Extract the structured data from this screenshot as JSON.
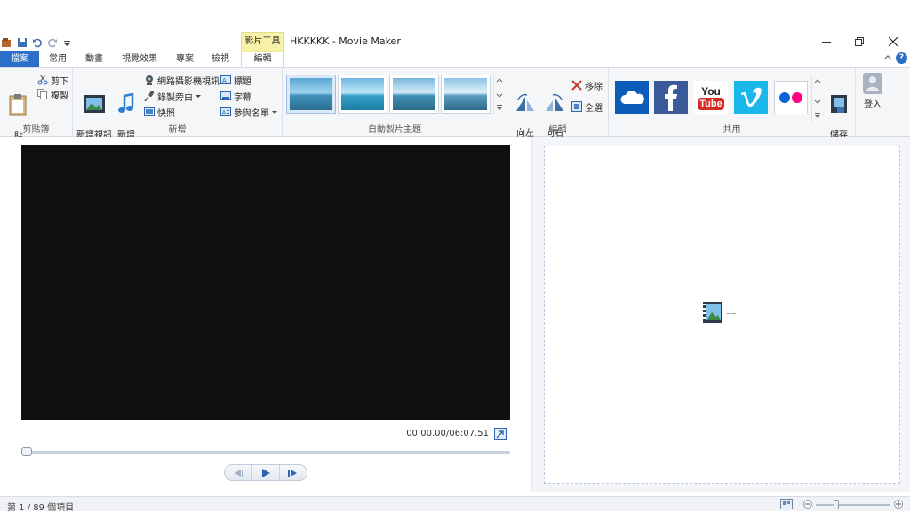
{
  "app": {
    "title": "HKKKKK - Movie Maker",
    "contextual_tab_group": "影片工具"
  },
  "tabs": [
    {
      "label": "檔案"
    },
    {
      "label": "常用"
    },
    {
      "label": "動畫"
    },
    {
      "label": "視覺效果"
    },
    {
      "label": "專案"
    },
    {
      "label": "檢視"
    },
    {
      "label": "編輯"
    }
  ],
  "ribbon": {
    "clipboard": {
      "label": "剪貼簿",
      "paste": "貼\n上",
      "cut": "剪下",
      "copy": "複製"
    },
    "add": {
      "label": "新增",
      "add_videos_photos": "新增視訊\n與相片",
      "add_music": "新增\n音樂",
      "webcam_video": "網路攝影機視訊",
      "record_narration": "錄製旁白",
      "snapshot": "快照",
      "title": "標題",
      "caption": "字幕",
      "credits": "參與名單"
    },
    "automovie_themes": {
      "label": "自動製片主題",
      "themes": [
        "theme-1",
        "theme-2",
        "theme-3",
        "theme-4"
      ],
      "selected_index": 0
    },
    "editing": {
      "label": "編輯",
      "rotate_left": "向左\n旋轉",
      "rotate_right": "向右\n旋轉",
      "remove": "移除",
      "select_all": "全選"
    },
    "share": {
      "label": "共用",
      "services": [
        "onedrive-icon",
        "facebook-icon",
        "youtube-icon",
        "vimeo-icon",
        "flickr-icon"
      ],
      "youtube_text_top": "You",
      "youtube_text_bottom": "Tube",
      "save_movie": "儲存\n影片"
    },
    "sign_in": "登入"
  },
  "preview": {
    "time": "00:00.00/06:07.51",
    "seek_position": 0.0
  },
  "storyboard": {
    "clip_label": "~~"
  },
  "status": {
    "text": "第 1 / 89 個項目"
  }
}
